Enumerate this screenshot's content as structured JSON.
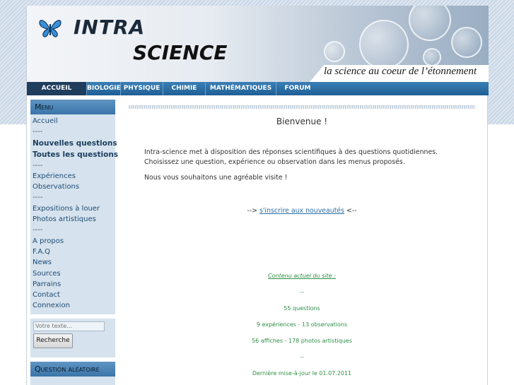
{
  "header": {
    "logo_word1": "INTRA",
    "logo_word2": "SCIENCE",
    "tagline": "la science au coeur de l’étonnement"
  },
  "nav": {
    "items": [
      "ACCUEIL",
      "BIOLOGIE",
      "PHYSIQUE",
      "CHIMIE",
      "MATHÉMATIQUES",
      "FORUM"
    ],
    "active": "ACCUEIL"
  },
  "sidebar": {
    "menu_title": "Menu",
    "menu_items": [
      {
        "label": "Accueil",
        "type": "link"
      },
      {
        "label": "----",
        "type": "sep"
      },
      {
        "label": "Nouvelles questions",
        "type": "bold"
      },
      {
        "label": "Toutes les questions",
        "type": "bold"
      },
      {
        "label": "----",
        "type": "sep"
      },
      {
        "label": "Expériences",
        "type": "link"
      },
      {
        "label": "Observations",
        "type": "link"
      },
      {
        "label": "----",
        "type": "sep"
      },
      {
        "label": "Expositions à louer",
        "type": "link"
      },
      {
        "label": "Photos artistiques",
        "type": "link"
      },
      {
        "label": "----",
        "type": "sep"
      },
      {
        "label": "A propos",
        "type": "link"
      },
      {
        "label": "F.A.Q",
        "type": "link"
      },
      {
        "label": "News",
        "type": "link"
      },
      {
        "label": "Sources",
        "type": "link"
      },
      {
        "label": "Parrains",
        "type": "link"
      },
      {
        "label": "Contact",
        "type": "link"
      },
      {
        "label": "Connexion",
        "type": "link"
      }
    ],
    "search_placeholder": "Votre texte...",
    "search_button": "Recherche",
    "random_title": "Question aléatoire"
  },
  "main": {
    "welcome": "Bienvenue !",
    "para1": "Intra-science met à disposition des réponses scientifiques à des questions quotidiennes. Choisissez une question, expérience ou observation dans les menus proposés.",
    "para2": "Nous vous souhaitons une agréable visite !",
    "signup_prefix": "--> ",
    "signup_link": "s'inscrire aux nouveautés",
    "signup_suffix": " <--",
    "content_title": "Contenu actuel du site :",
    "content_lines": [
      "--",
      "55 questions",
      "9 expériences - 13 observations",
      "56 affiches - 178 photos artistiques",
      "--",
      "Dernière mise-à-jour le 01.07.2011"
    ]
  },
  "colors": {
    "nav_blue": "#2b6ea5",
    "sidebar_bg": "#d6e3ee",
    "stats_green": "#2f8f47",
    "link_blue": "#2a6fa8"
  }
}
